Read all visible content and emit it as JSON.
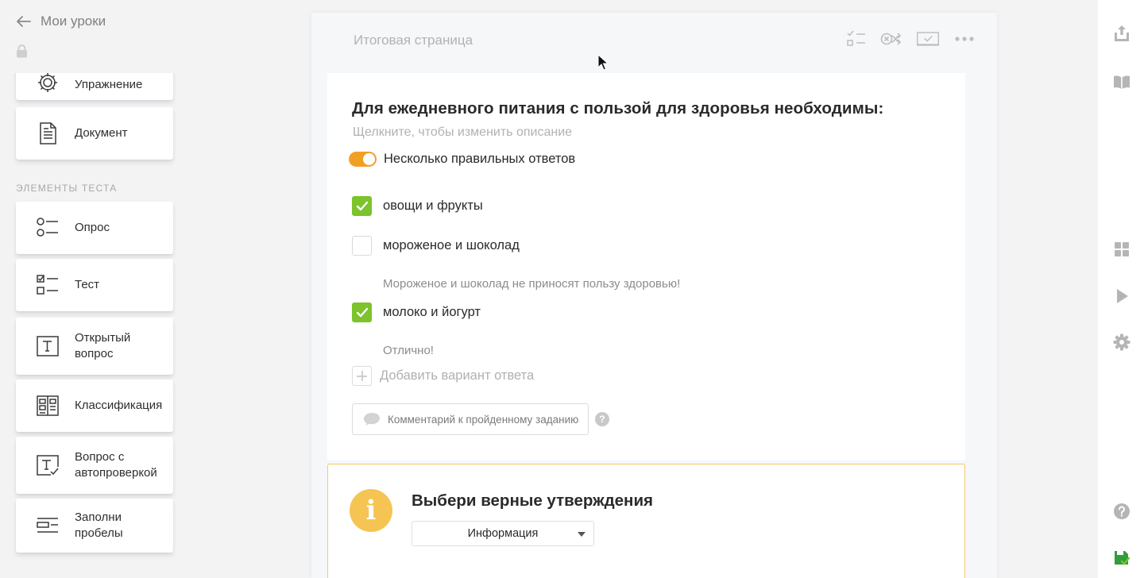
{
  "header": {
    "back_label": "Мои уроки"
  },
  "sidebar": {
    "section_label": "ЭЛЕМЕНТЫ ТЕСТА",
    "top_items": [
      {
        "label": "Упражнение",
        "icon": "gear-icon"
      },
      {
        "label": "Документ",
        "icon": "document-icon"
      }
    ],
    "test_items": [
      {
        "label": "Опрос",
        "icon": "poll-icon"
      },
      {
        "label": "Тест",
        "icon": "checklist-icon"
      },
      {
        "label": "Открытый вопрос",
        "icon": "text-box-icon"
      },
      {
        "label": "Классификация",
        "icon": "columns-icon"
      },
      {
        "label": "Вопрос с автопроверкой",
        "icon": "text-check-icon"
      },
      {
        "label": "Заполни пробелы",
        "icon": "fill-gaps-icon"
      }
    ]
  },
  "page": {
    "title": "Итоговая страница",
    "tools": [
      "checklist-icon",
      "shuffle-icon",
      "check-screen-icon",
      "more-icon"
    ]
  },
  "question": {
    "title": "Для ежедневного питания с пользой для здоровья необходимы:",
    "description": "Щелкните, чтобы изменить описание",
    "multiple_answers": {
      "label": "Несколько правильных ответов",
      "enabled": true
    },
    "answers": [
      {
        "text": "овощи и фрукты",
        "checked": true,
        "feedback": ""
      },
      {
        "text": "мороженое и шоколад",
        "checked": false,
        "feedback": "Мороженое и шоколад не приносят пользу здоровью!"
      },
      {
        "text": "молоко и йогурт",
        "checked": true,
        "feedback": "Отлично!"
      }
    ],
    "add_answer_label": "Добавить вариант ответа",
    "comment_button_label": "Комментарий к пройденному заданию",
    "help_symbol": "?"
  },
  "info_block": {
    "icon_symbol": "i",
    "title": "Выбери верные утверждения",
    "select_value": "Информация"
  },
  "right_rail": {
    "top_icons": [
      "upload-icon",
      "book-icon"
    ],
    "middle_icons": [
      "grid-icon",
      "play-icon",
      "settings-icon"
    ],
    "bottom_icons": [
      "help-icon",
      "save-icon"
    ]
  },
  "colors": {
    "accent_orange": "#f2a023",
    "check_green": "#7cc32c",
    "info_yellow": "#f6c453",
    "info_border": "#f4cb66"
  }
}
